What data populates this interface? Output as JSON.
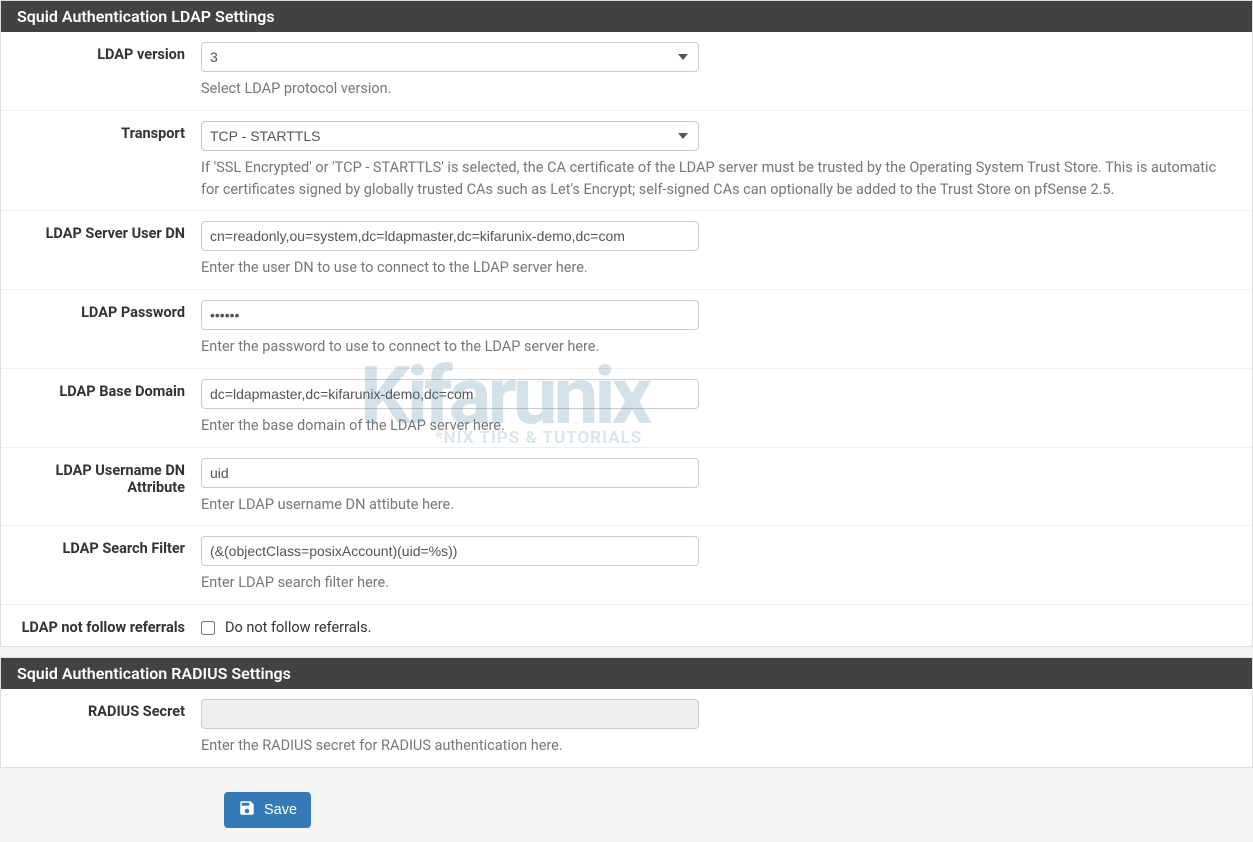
{
  "watermark": {
    "main": "Kifarunix",
    "sub": "*NIX TIPS & TUTORIALS"
  },
  "ldap_panel": {
    "title": "Squid Authentication LDAP Settings",
    "version": {
      "label": "LDAP version",
      "value": "3",
      "help": "Select LDAP protocol version."
    },
    "transport": {
      "label": "Transport",
      "value": "TCP - STARTTLS",
      "help": "If 'SSL Encrypted' or 'TCP - STARTTLS' is selected, the CA certificate of the LDAP server must be trusted by the Operating System Trust Store. This is automatic for certificates signed by globally trusted CAs such as Let's Encrypt; self-signed CAs can optionally be added to the Trust Store on pfSense 2.5."
    },
    "user_dn": {
      "label": "LDAP Server User DN",
      "value": "cn=readonly,ou=system,dc=ldapmaster,dc=kifarunix-demo,dc=com",
      "help": "Enter the user DN to use to connect to the LDAP server here."
    },
    "password": {
      "label": "LDAP Password",
      "value": "••••••",
      "help": "Enter the password to use to connect to the LDAP server here."
    },
    "base_domain": {
      "label": "LDAP Base Domain",
      "value": "dc=ldapmaster,dc=kifarunix-demo,dc=com",
      "help": "Enter the base domain of the LDAP server here."
    },
    "username_dn_attr": {
      "label": "LDAP Username DN Attribute",
      "value": "uid",
      "help": "Enter LDAP username DN attibute here."
    },
    "search_filter": {
      "label": "LDAP Search Filter",
      "value": "(&(objectClass=posixAccount)(uid=%s))",
      "help": "Enter LDAP search filter here."
    },
    "no_referrals": {
      "label": "LDAP not follow referrals",
      "checkbox_label": "Do not follow referrals."
    }
  },
  "radius_panel": {
    "title": "Squid Authentication RADIUS Settings",
    "secret": {
      "label": "RADIUS Secret",
      "value": "",
      "help": "Enter the RADIUS secret for RADIUS authentication here."
    }
  },
  "buttons": {
    "save": "Save"
  }
}
